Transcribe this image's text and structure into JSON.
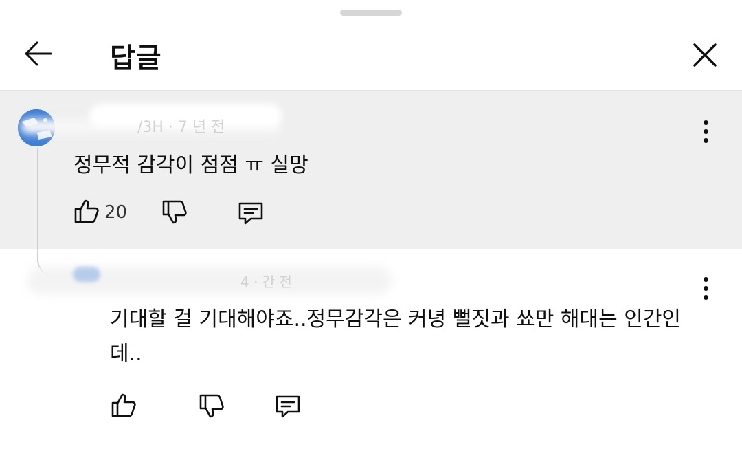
{
  "header": {
    "title": "답글"
  },
  "parent_comment": {
    "meta": "/3H · 7 년 전",
    "text": "정무적 감각이 점점  ㅠ 실망",
    "likes": "20"
  },
  "reply": {
    "meta": "4 · 간 전",
    "text": "기대할 걸 기대해야죠..정무감각은 커녕 뻘짓과 쑈만 해대는 인간인데.."
  },
  "icons": [
    "back-arrow-icon",
    "close-icon",
    "more-vert-icon",
    "thumb-up-icon",
    "thumb-down-icon",
    "reply-icon"
  ],
  "colors": {
    "parent_bg": "#efefef",
    "text": "#0f0f0f",
    "avatar": "#3e7fd6"
  }
}
